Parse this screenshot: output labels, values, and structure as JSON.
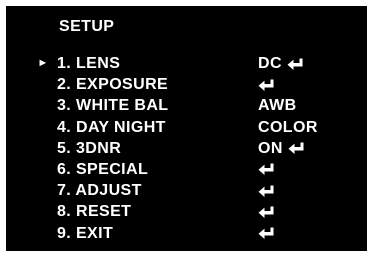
{
  "menu": {
    "title": "SETUP",
    "cursor": "►",
    "items": [
      {
        "label": "1. LENS",
        "value": "DC",
        "enter": true,
        "selected": true
      },
      {
        "label": "2. EXPOSURE",
        "value": "",
        "enter": true,
        "selected": false
      },
      {
        "label": "3. WHITE BAL",
        "value": "AWB",
        "enter": false,
        "selected": false
      },
      {
        "label": "4. DAY NIGHT",
        "value": "COLOR",
        "enter": false,
        "selected": false
      },
      {
        "label": "5. 3DNR",
        "value": "ON",
        "enter": true,
        "selected": false
      },
      {
        "label": "6. SPECIAL",
        "value": "",
        "enter": true,
        "selected": false
      },
      {
        "label": "7. ADJUST",
        "value": "",
        "enter": true,
        "selected": false
      },
      {
        "label": "8. RESET",
        "value": "",
        "enter": true,
        "selected": false
      },
      {
        "label": "9. EXIT",
        "value": "",
        "enter": true,
        "selected": false
      }
    ]
  },
  "colors": {
    "background": "#000000",
    "text": "#ffffff"
  },
  "icons": {
    "enter": "enter-return-arrow-icon",
    "cursor": "right-pointer-icon"
  }
}
